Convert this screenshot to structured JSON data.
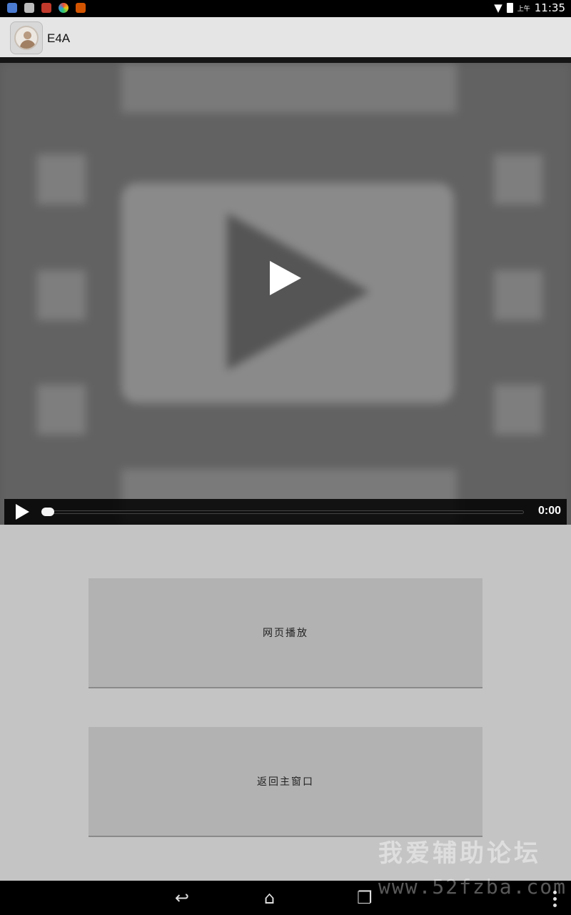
{
  "status_bar": {
    "time": "11:35",
    "ampm": "上午",
    "left_icons": [
      "shield-icon",
      "image-icon",
      "shield-icon",
      "color-wheel-icon",
      "shield-icon"
    ],
    "right_icons": [
      "wifi-icon",
      "battery-icon"
    ]
  },
  "app": {
    "title": "E4A"
  },
  "video_player": {
    "current_time": "0:00",
    "progress": 0
  },
  "buttons": {
    "web_play": "网页播放",
    "back_main": "返回主窗口"
  },
  "watermark": {
    "title": "我爱辅助论坛",
    "url": "www.52fzba.com"
  },
  "nav_bar": {
    "icons": [
      "back-icon",
      "home-icon",
      "recent-apps-icon",
      "menu-icon"
    ]
  }
}
